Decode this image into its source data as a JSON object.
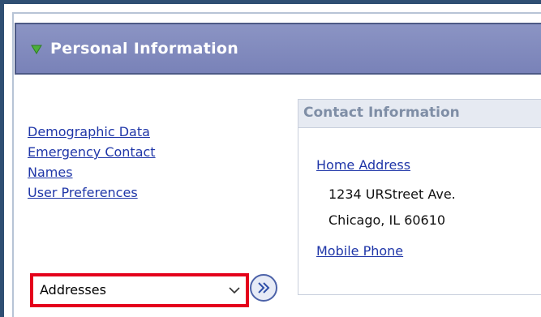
{
  "header": {
    "title": "Personal Information"
  },
  "links": [
    {
      "label": "Demographic Data"
    },
    {
      "label": "Emergency Contact"
    },
    {
      "label": "Names"
    },
    {
      "label": "User Preferences"
    }
  ],
  "contact": {
    "heading": "Contact Information",
    "home_address_label": "Home Address",
    "address_line1": "1234 URStreet Ave.",
    "address_line2": "Chicago, IL 60610",
    "mobile_phone_label": "Mobile Phone"
  },
  "select": {
    "value": "Addresses"
  },
  "colors": {
    "header": "#7982b8",
    "link": "#1f36a8",
    "highlight": "#e4001b"
  },
  "icons": {
    "collapse": "triangle-down-icon",
    "dropdown": "chevron-down-icon",
    "go": "double-chevron-right-icon"
  }
}
